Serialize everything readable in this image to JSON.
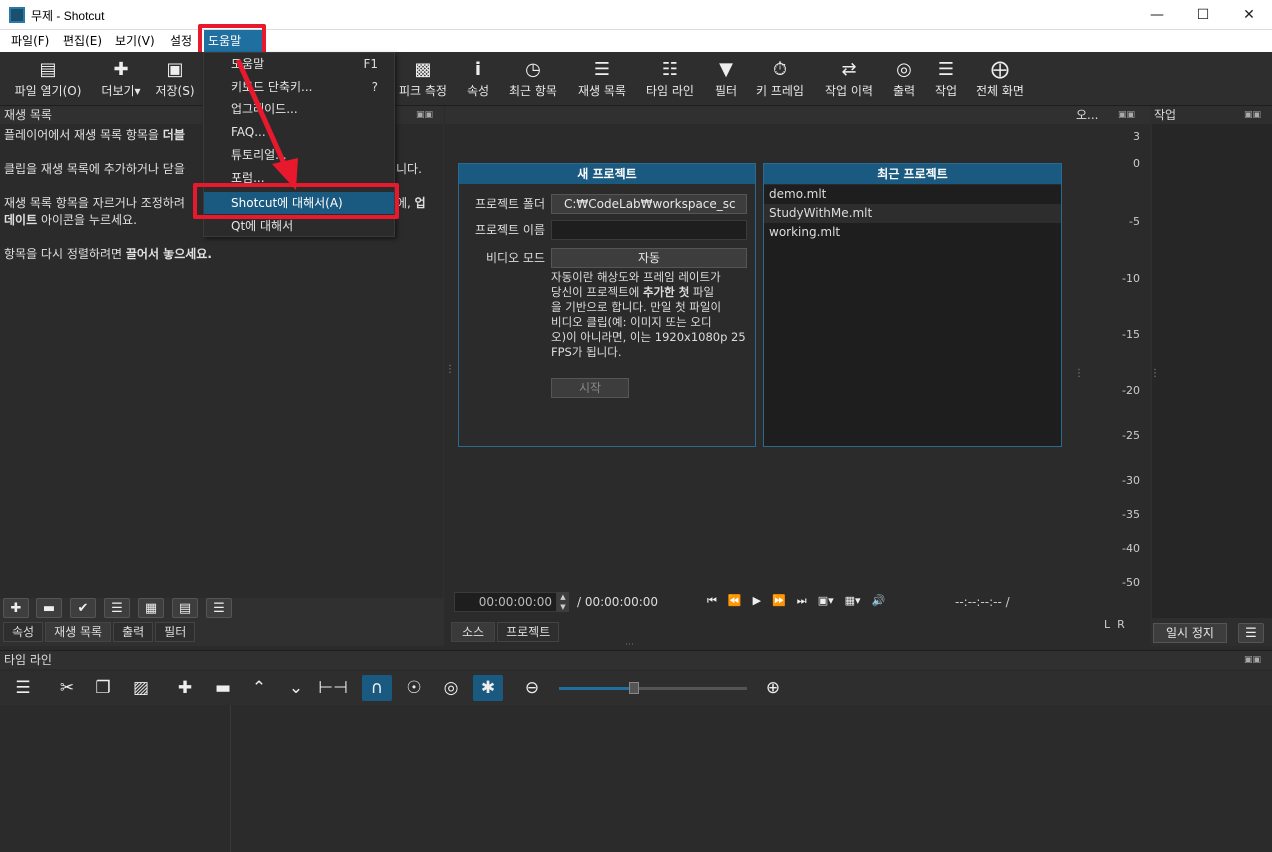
{
  "window": {
    "title": "무제 - Shotcut"
  },
  "menubar": {
    "items": [
      {
        "label": "파일(F)"
      },
      {
        "label": "편집(E)"
      },
      {
        "label": "보기(V)"
      },
      {
        "label": "설정"
      },
      {
        "label": "도움말(H)"
      }
    ]
  },
  "toolbar": {
    "items": [
      {
        "label": "파일 열기(O)",
        "icon": "folder-open-icon"
      },
      {
        "label": "더보기",
        "icon": "file-add-icon"
      },
      {
        "label": "저장(S)",
        "icon": "save-icon"
      },
      {
        "label": "피크 측정",
        "icon": "peak-meter-icon"
      },
      {
        "label": "속성",
        "icon": "info-icon"
      },
      {
        "label": "최근 항목",
        "icon": "clock-icon"
      },
      {
        "label": "재생 목록",
        "icon": "list-icon"
      },
      {
        "label": "타임 라인",
        "icon": "timeline-icon"
      },
      {
        "label": "필터",
        "icon": "filter-icon"
      },
      {
        "label": "키 프레임",
        "icon": "stopwatch-icon"
      },
      {
        "label": "작업 이력",
        "icon": "history-icon"
      },
      {
        "label": "출력",
        "icon": "disc-icon"
      },
      {
        "label": "작업",
        "icon": "database-icon"
      },
      {
        "label": "전체 화면",
        "icon": "fullscreen-icon"
      }
    ]
  },
  "help_menu": {
    "items": [
      {
        "label": "도움말",
        "shortcut": "F1"
      },
      {
        "label": "키보드 단축키...",
        "shortcut": "?"
      },
      {
        "label": "업그레이드...",
        "shortcut": ""
      },
      {
        "label": "FAQ...",
        "shortcut": ""
      },
      {
        "label": "튜토리얼...",
        "shortcut": ""
      },
      {
        "label": "포럼...",
        "shortcut": ""
      },
      {
        "label": "Shotcut에 대해서(A)",
        "shortcut": ""
      },
      {
        "label": "Qt에 대해서",
        "shortcut": ""
      }
    ]
  },
  "playlist": {
    "title": "재생 목록",
    "p1a": "플레이어에서 재생 목록 항목을 ",
    "p1b": "더블",
    "p2": "클립을 재생 목록에 추가하거나 닫을",
    "p2end": "니다.",
    "p3a": "재생 목록 항목을 자르거나 조정하려",
    "p3b": "에, ",
    "p3c": "업",
    "p3d": "데이트",
    "p3e": " 아이콘을 누르세요.",
    "p4a": "항목을 다시 정렬하려면 ",
    "p4b": "끌어서 놓으세요."
  },
  "bottom_tabs_left": [
    "속성",
    "재생 목록",
    "출력",
    "필터"
  ],
  "new_project": {
    "title": "새 프로젝트",
    "folder_label": "프로젝트 폴더",
    "folder_value": "C:₩CodeLab₩workspace_sc",
    "name_label": "프로젝트 이름",
    "name_value": "",
    "video_mode_label": "비디오 모드",
    "video_mode_value": "자동",
    "desc_1": "자동이란 해상도와 프레임 레이트가",
    "desc_2a": "당신이 프로젝트에 ",
    "desc_2b": "추가한 첫",
    "desc_2c": " 파일",
    "desc_3": "을 기반으로 합니다. 만일 첫 파일이",
    "desc_4": "비디오 클립(예: 이미지 또는 오디",
    "desc_5": "오)이 아니라면, 이는 1920x1080p 25",
    "desc_6": "FPS가 됩니다.",
    "start_button": "시작"
  },
  "recent_projects": {
    "title": "최근 프로젝트",
    "items": [
      "demo.mlt",
      "StudyWithMe.mlt",
      "working.mlt"
    ]
  },
  "transport": {
    "position": "00:00:00:00",
    "duration": "/ 00:00:00:00",
    "remaining": "--:--:--:-- /"
  },
  "viewer_tabs": [
    "소스",
    "프로젝트"
  ],
  "meter": {
    "title": "오...",
    "ticks": [
      "3",
      "0",
      "-5",
      "-10",
      "-15",
      "-20",
      "-25",
      "-30",
      "-35",
      "-40",
      "-50"
    ],
    "lr": "L  R"
  },
  "jobs": {
    "title": "작업",
    "pause_button": "일시 정지"
  },
  "timeline": {
    "title": "타임 라인",
    "zoom_level": 0.4
  }
}
